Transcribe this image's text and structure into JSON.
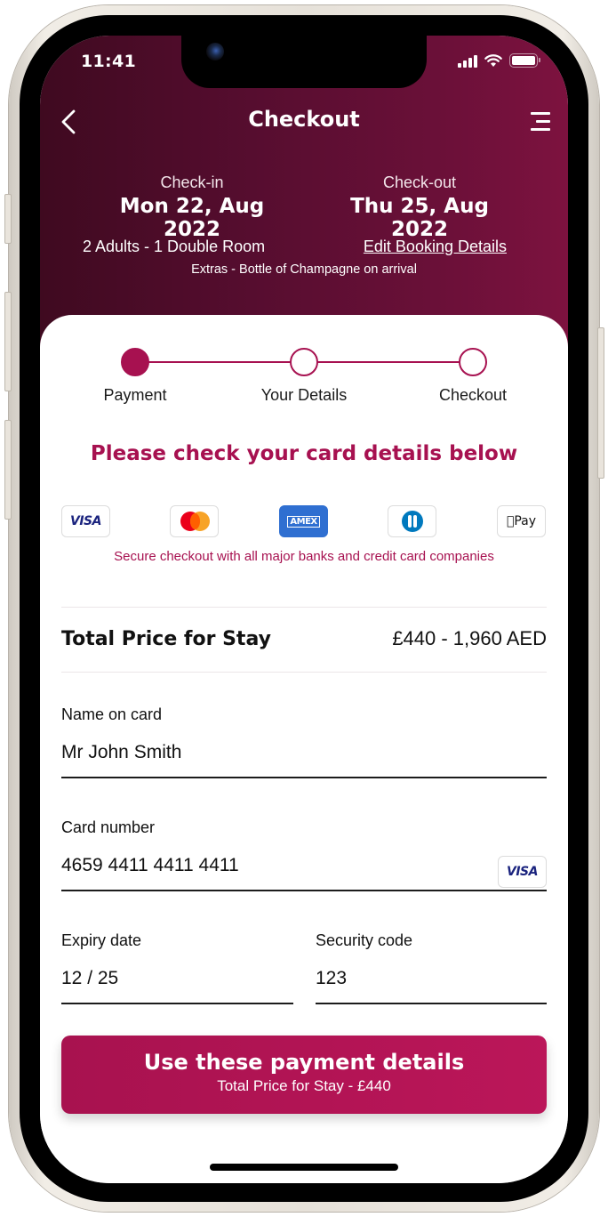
{
  "status_bar": {
    "time": "11:41",
    "icons": [
      "cellular-signal-icon",
      "wifi-icon",
      "battery-icon"
    ]
  },
  "nav": {
    "back_icon": "chevron-left-icon",
    "title": "Checkout",
    "menu_icon": "menu-icon"
  },
  "booking": {
    "checkin_label": "Check-in",
    "checkin_date": "Mon 22, Aug 2022",
    "checkout_label": "Check-out",
    "checkout_date": "Thu 25, Aug 2022",
    "guests": "2 Adults - 1 Double Room",
    "edit_link": "Edit Booking Details",
    "extras": "Extras - Bottle of Champagne on arrival"
  },
  "stepper": {
    "steps": [
      {
        "label": "Payment",
        "state": "active"
      },
      {
        "label": "Your Details",
        "state": "inactive"
      },
      {
        "label": "Checkout",
        "state": "inactive"
      }
    ]
  },
  "payment": {
    "heading": "Please check your card details below",
    "card_logos": [
      {
        "name": "visa",
        "label": "VISA"
      },
      {
        "name": "mastercard",
        "label": ""
      },
      {
        "name": "amex",
        "label": "AMEX"
      },
      {
        "name": "diners-club",
        "label": ""
      },
      {
        "name": "apple-pay",
        "label": "Pay"
      }
    ],
    "secure_note": "Secure checkout with all major banks and credit card companies"
  },
  "total": {
    "label": "Total Price for Stay",
    "value": "£440 - 1,960 AED"
  },
  "form": {
    "name_label": "Name on card",
    "name_value": "Mr John Smith",
    "card_label": "Card number",
    "card_value": "4659 4411 4411 4411",
    "card_brand": "VISA",
    "expiry_label": "Expiry date",
    "expiry_value": "12 / 25",
    "cvc_label": "Security code",
    "cvc_value": "123"
  },
  "cta": {
    "label": "Use these payment details",
    "sublabel": "Total Price for Stay - £440"
  },
  "colors": {
    "brand": "#a71150",
    "header_dark": "#3f0a20",
    "header_light": "#7d123f",
    "cta": "#bb1659"
  }
}
